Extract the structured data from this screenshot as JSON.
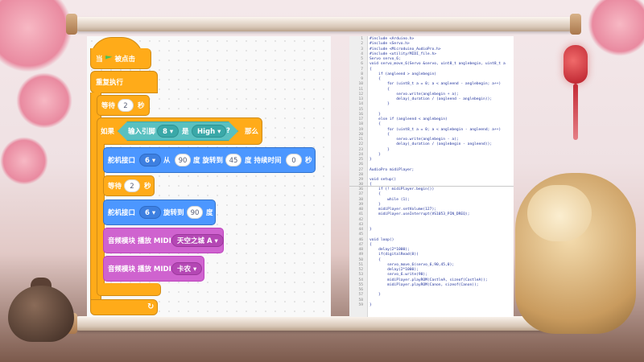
{
  "blocks": {
    "hat": {
      "prefix": "当",
      "flag_icon": "green-flag-icon",
      "suffix": "被点击"
    },
    "forever": {
      "label": "重复执行"
    },
    "wait1": {
      "label": "等待",
      "value": "2",
      "unit": "秒"
    },
    "if_block": {
      "if_label": "如果",
      "input_label": "输入引脚",
      "pin": "8",
      "is_label": "是",
      "level": "High",
      "question": "?",
      "then_label": "那么"
    },
    "servo_move": {
      "label": "舵机接口",
      "port": "6",
      "from_label": "从",
      "from": "90",
      "deg1": "度 旋转到",
      "to": "45",
      "deg2": "度 持续时间",
      "duration": "0",
      "sec": "秒"
    },
    "wait2": {
      "label": "等待",
      "value": "2",
      "unit": "秒"
    },
    "servo_rotate": {
      "label": "舵机接口",
      "port": "6",
      "rotate_label": "旋转到",
      "angle": "90",
      "unit": "度"
    },
    "midi1": {
      "label": "音频模块 播放 MIDI",
      "song": "天空之城 A"
    },
    "midi2": {
      "label": "音频模块 播放 MIDI",
      "song": "卡农"
    },
    "loop_arrow_icon": "loop-arrow-icon"
  },
  "code_top": [
    {
      "n": "1",
      "t": "#include <Arduino.h>"
    },
    {
      "n": "2",
      "t": "#include <Servo.h>"
    },
    {
      "n": "3",
      "t": "#include <Microduino_AudioPro.h>"
    },
    {
      "n": "4",
      "t": "#include <utility/MIDI_file.h>"
    },
    {
      "n": "5",
      "t": "Servo servo_6;"
    },
    {
      "n": "6",
      "t": "void servo_move_6(Servo &servo, uint8_t anglebegin, uint8_t a"
    },
    {
      "n": "7",
      "t": "{"
    },
    {
      "n": "8",
      "t": "    if (angleend > anglebegin)"
    },
    {
      "n": "9",
      "t": "    {"
    },
    {
      "n": "10",
      "t": "        for (uint8_t a = 0; a < angleend - anglebegin; a++)"
    },
    {
      "n": "11",
      "t": "        {"
    },
    {
      "n": "12",
      "t": "            servo.write(anglebegin + a);"
    },
    {
      "n": "13",
      "t": "            delay(_duration / (angleend - anglebegin));"
    },
    {
      "n": "14",
      "t": "        }"
    },
    {
      "n": "15",
      "t": ""
    },
    {
      "n": "16",
      "t": "    }"
    },
    {
      "n": "17",
      "t": "    else if (angleend < anglebegin)"
    },
    {
      "n": "18",
      "t": "    {"
    },
    {
      "n": "19",
      "t": "        for (uint8_t a = 0; a < anglebegin - angleend; a++)"
    },
    {
      "n": "20",
      "t": "        {"
    },
    {
      "n": "21",
      "t": "            servo.write(anglebegin - a);"
    },
    {
      "n": "22",
      "t": "            delay(_duration / (anglebegin - angleend));"
    },
    {
      "n": "23",
      "t": "        }"
    },
    {
      "n": "24",
      "t": "    }"
    },
    {
      "n": "25",
      "t": "}"
    },
    {
      "n": "26",
      "t": ""
    },
    {
      "n": "27",
      "t": "AudioPro midiPlayer;"
    },
    {
      "n": "28",
      "t": ""
    },
    {
      "n": "29",
      "t": "void setup()"
    },
    {
      "n": "30",
      "t": "{"
    },
    {
      "n": "31",
      "t": "    pinMode(8, INPUT);"
    },
    {
      "n": "32",
      "t": "    servo_6.attach(6);"
    }
  ],
  "code_bottom": [
    {
      "n": "36",
      "t": "    if (! midiPlayer.begin())"
    },
    {
      "n": "37",
      "t": "    {"
    },
    {
      "n": "38",
      "t": "        while (1);"
    },
    {
      "n": "39",
      "t": "    }"
    },
    {
      "n": "40",
      "t": "    midiPlayer.setVolume(127);"
    },
    {
      "n": "41",
      "t": "    midiPlayer.useInterrupt(VS1053_PIN_DREQ);"
    },
    {
      "n": "42",
      "t": ""
    },
    {
      "n": "43",
      "t": ""
    },
    {
      "n": "44",
      "t": "}"
    },
    {
      "n": "45",
      "t": ""
    },
    {
      "n": "46",
      "t": "void loop()"
    },
    {
      "n": "47",
      "t": "{"
    },
    {
      "n": "48",
      "t": "    delay(2*1000);"
    },
    {
      "n": "49",
      "t": "    if(digitalRead(8))"
    },
    {
      "n": "50",
      "t": "    {"
    },
    {
      "n": "51",
      "t": "        servo_move_6(servo_6,90,45,0);"
    },
    {
      "n": "52",
      "t": "        delay(2*1000);"
    },
    {
      "n": "53",
      "t": "        servo_6.write(90);"
    },
    {
      "n": "54",
      "t": "        midiPlayer.playROM(CastleA, sizeof(CastleA));"
    },
    {
      "n": "55",
      "t": "        midiPlayer.playROM(Canon, sizeof(Canon));"
    },
    {
      "n": "56",
      "t": ""
    },
    {
      "n": "57",
      "t": "    }"
    },
    {
      "n": "58",
      "t": ""
    },
    {
      "n": "59",
      "t": "}"
    }
  ]
}
